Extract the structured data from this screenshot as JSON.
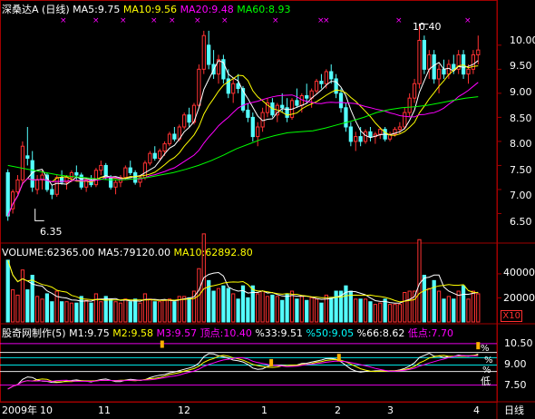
{
  "header": {
    "stock": "深桑达A",
    "period": "(日线)",
    "ma5": "MA5:9.75",
    "ma10": "MA10:9.56",
    "ma20": "MA20:9.48",
    "ma60": "MA60:8.93",
    "colors": {
      "stock": "#ffffff",
      "ma5": "#ffffff",
      "ma10": "#ffff00",
      "ma20": "#ff00ff",
      "ma60": "#00ff00"
    }
  },
  "price_axis": {
    "ticks": [
      "10.00",
      "9.50",
      "9.00",
      "8.50",
      "8.00",
      "7.50",
      "7.00",
      "6.50"
    ]
  },
  "annotations": {
    "high": "10.40",
    "low": "6.35"
  },
  "volume_panel": {
    "vol": "VOLUME:62365.00",
    "ma5": "MA5:79120.00",
    "ma10": "MA10:62892.80",
    "ticks": [
      "40000",
      "20000"
    ],
    "scale_badge": "X10"
  },
  "indicator_panel": {
    "name": "股奇网制作(5)",
    "m1": "M1:9.75",
    "m2": "M2:9.58",
    "m3": "M3:9.57",
    "top": "顶点:10.40",
    "p33": "%33:9.51",
    "p50": "%50:9.05",
    "p66": "%66:8.62",
    "bottom": "低点:7.70",
    "ticks": [
      "10.50",
      "9.00",
      "7.50"
    ],
    "side_marks": [
      "%",
      "%",
      "%",
      "低"
    ]
  },
  "time_axis": {
    "labels": [
      "2009年",
      "10",
      "11",
      "12",
      "1",
      "2",
      "3",
      "4"
    ],
    "period_button": "日线"
  },
  "chart_data": {
    "type": "candlestick",
    "price_ylim": [
      6.0,
      10.6
    ],
    "candles_ohlc": [
      [
        7.35,
        7.42,
        6.35,
        6.45
      ],
      [
        6.6,
        7.0,
        6.5,
        6.95
      ],
      [
        6.95,
        7.3,
        6.9,
        7.2
      ],
      [
        7.2,
        8.0,
        7.1,
        7.9
      ],
      [
        7.7,
        8.3,
        7.5,
        7.65
      ],
      [
        7.6,
        7.8,
        6.95,
        7.05
      ],
      [
        7.0,
        7.3,
        6.9,
        7.2
      ],
      [
        7.2,
        7.4,
        7.0,
        7.3
      ],
      [
        7.3,
        7.35,
        6.95,
        7.0
      ],
      [
        7.0,
        7.1,
        6.8,
        6.9
      ],
      [
        6.9,
        7.3,
        6.85,
        7.25
      ],
      [
        7.25,
        7.4,
        7.1,
        7.15
      ],
      [
        7.15,
        7.3,
        7.0,
        7.25
      ],
      [
        7.25,
        7.4,
        7.15,
        7.35
      ],
      [
        7.35,
        7.5,
        7.2,
        7.3
      ],
      [
        7.3,
        7.35,
        7.0,
        7.05
      ],
      [
        7.05,
        7.25,
        6.95,
        7.2
      ],
      [
        7.2,
        7.3,
        7.05,
        7.1
      ],
      [
        7.1,
        7.45,
        7.05,
        7.4
      ],
      [
        7.4,
        7.6,
        7.3,
        7.5
      ],
      [
        7.5,
        7.55,
        7.2,
        7.25
      ],
      [
        7.25,
        7.3,
        7.0,
        7.05
      ],
      [
        7.05,
        7.2,
        6.9,
        7.15
      ],
      [
        7.15,
        7.3,
        7.05,
        7.25
      ],
      [
        7.25,
        7.5,
        7.2,
        7.45
      ],
      [
        7.45,
        7.6,
        7.3,
        7.35
      ],
      [
        7.35,
        7.4,
        7.1,
        7.15
      ],
      [
        7.15,
        7.3,
        7.05,
        7.25
      ],
      [
        7.25,
        7.6,
        7.2,
        7.55
      ],
      [
        7.55,
        7.8,
        7.5,
        7.75
      ],
      [
        7.75,
        7.9,
        7.6,
        7.65
      ],
      [
        7.65,
        7.85,
        7.6,
        7.8
      ],
      [
        7.8,
        8.0,
        7.7,
        7.95
      ],
      [
        7.95,
        8.2,
        7.9,
        8.15
      ],
      [
        8.15,
        8.3,
        8.0,
        8.05
      ],
      [
        8.05,
        8.35,
        8.0,
        8.3
      ],
      [
        8.3,
        8.6,
        8.25,
        8.55
      ],
      [
        8.55,
        8.7,
        8.3,
        8.4
      ],
      [
        8.4,
        8.8,
        8.35,
        8.75
      ],
      [
        8.75,
        9.6,
        8.7,
        9.5
      ],
      [
        9.5,
        10.3,
        9.4,
        10.2
      ],
      [
        10.0,
        10.3,
        9.5,
        9.6
      ],
      [
        9.6,
        9.9,
        9.3,
        9.4
      ],
      [
        9.4,
        9.8,
        9.2,
        9.7
      ],
      [
        9.7,
        9.8,
        9.2,
        9.3
      ],
      [
        9.3,
        9.5,
        8.9,
        9.0
      ],
      [
        9.0,
        9.3,
        8.8,
        9.2
      ],
      [
        9.2,
        9.4,
        9.0,
        9.1
      ],
      [
        9.1,
        9.15,
        8.6,
        8.65
      ],
      [
        8.65,
        8.8,
        8.4,
        8.5
      ],
      [
        8.5,
        8.6,
        8.0,
        8.1
      ],
      [
        8.1,
        8.4,
        7.9,
        8.3
      ],
      [
        8.3,
        8.7,
        8.2,
        8.6
      ],
      [
        8.6,
        8.9,
        8.5,
        8.8
      ],
      [
        8.8,
        8.9,
        8.5,
        8.55
      ],
      [
        8.55,
        8.8,
        8.4,
        8.75
      ],
      [
        8.75,
        9.0,
        8.6,
        8.7
      ],
      [
        8.7,
        8.9,
        8.4,
        8.5
      ],
      [
        8.5,
        8.9,
        8.45,
        8.85
      ],
      [
        8.85,
        9.1,
        8.7,
        8.75
      ],
      [
        8.75,
        9.0,
        8.6,
        8.95
      ],
      [
        8.95,
        9.2,
        8.8,
        8.9
      ],
      [
        8.9,
        9.1,
        8.7,
        9.05
      ],
      [
        9.05,
        9.3,
        9.0,
        9.25
      ],
      [
        9.25,
        9.4,
        9.1,
        9.2
      ],
      [
        9.2,
        9.5,
        9.1,
        9.45
      ],
      [
        9.45,
        9.6,
        9.2,
        9.3
      ],
      [
        9.3,
        9.4,
        8.9,
        9.0
      ],
      [
        9.0,
        9.1,
        8.6,
        8.7
      ],
      [
        8.7,
        8.8,
        8.2,
        8.3
      ],
      [
        8.3,
        8.4,
        7.9,
        8.0
      ],
      [
        8.0,
        8.2,
        7.8,
        8.1
      ],
      [
        8.1,
        8.3,
        7.9,
        8.0
      ],
      [
        8.0,
        8.25,
        7.95,
        8.2
      ],
      [
        8.2,
        8.3,
        8.0,
        8.1
      ],
      [
        8.1,
        8.2,
        7.95,
        8.15
      ],
      [
        8.15,
        8.3,
        8.05,
        8.25
      ],
      [
        8.25,
        8.3,
        8.0,
        8.05
      ],
      [
        8.05,
        8.2,
        8.0,
        8.15
      ],
      [
        8.15,
        8.3,
        8.1,
        8.25
      ],
      [
        8.25,
        8.4,
        8.15,
        8.3
      ],
      [
        8.3,
        8.7,
        8.25,
        8.6
      ],
      [
        8.6,
        9.0,
        8.5,
        8.9
      ],
      [
        8.9,
        9.3,
        8.8,
        9.2
      ],
      [
        9.2,
        10.4,
        9.1,
        10.1
      ],
      [
        10.1,
        10.2,
        9.4,
        9.5
      ],
      [
        9.5,
        9.9,
        9.3,
        9.8
      ],
      [
        9.8,
        9.9,
        9.2,
        9.3
      ],
      [
        9.3,
        9.6,
        9.0,
        9.5
      ],
      [
        9.5,
        9.7,
        9.3,
        9.4
      ],
      [
        9.4,
        9.7,
        9.3,
        9.6
      ],
      [
        9.6,
        9.8,
        9.4,
        9.5
      ],
      [
        9.5,
        9.9,
        9.4,
        9.8
      ],
      [
        9.8,
        9.9,
        9.3,
        9.4
      ],
      [
        9.4,
        9.6,
        9.2,
        9.5
      ],
      [
        9.5,
        9.9,
        9.4,
        9.8
      ],
      [
        9.8,
        10.2,
        9.6,
        9.9
      ]
    ],
    "ma_lines": {
      "ma60": [
        7.5,
        7.45,
        7.4,
        7.35,
        7.3,
        7.27,
        7.25,
        7.22,
        7.2,
        7.2,
        7.22,
        7.25,
        7.3,
        7.35,
        7.42,
        7.5,
        7.6,
        7.72,
        7.85,
        7.95,
        8.05,
        8.12,
        8.18,
        8.2,
        8.22,
        8.28,
        8.35,
        8.42,
        8.5,
        8.6,
        8.66,
        8.7,
        8.72,
        8.75,
        8.8,
        8.85,
        8.9,
        8.93
      ]
    }
  }
}
